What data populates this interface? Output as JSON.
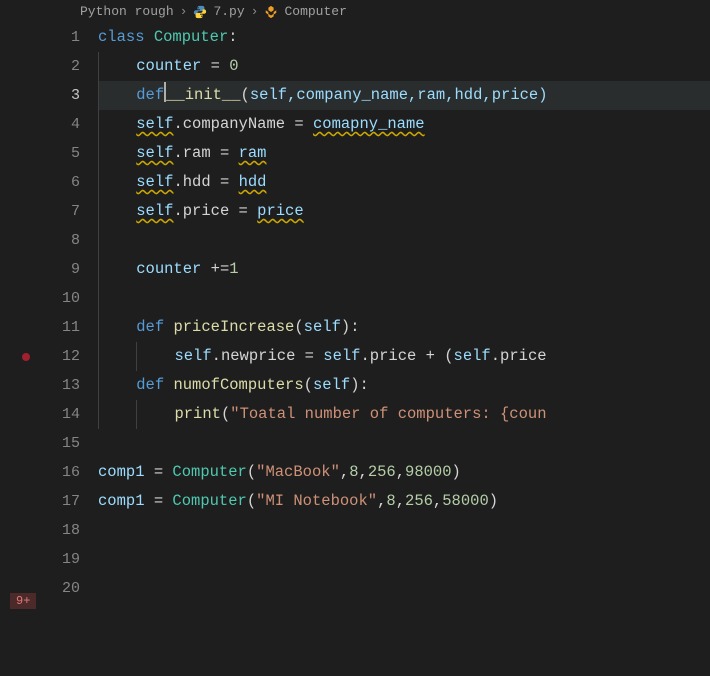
{
  "breadcrumb": {
    "root": "Python rough",
    "file": "7.py",
    "symbol": "Computer"
  },
  "editor": {
    "activeLine": 3,
    "badge": "9+"
  },
  "code": {
    "l1": {
      "kw": "class",
      "cls": "Computer",
      "colon": ":"
    },
    "l2": {
      "var": "counter",
      "eq": " = ",
      "num": "0"
    },
    "l3": {
      "kw": "def",
      "fn": "__init__",
      "open": "(",
      "self": "self",
      "params": ",company_name,ram,hdd,price)"
    },
    "l4": {
      "self": "self",
      "dot": ".companyName = ",
      "rhs": "comapny_name"
    },
    "l5": {
      "self": "self",
      "dot": ".ram = ",
      "rhs": "ram"
    },
    "l6": {
      "self": "self",
      "dot": ".hdd = ",
      "rhs": "hdd"
    },
    "l7": {
      "self": "self",
      "dot": ".price = ",
      "rhs": "price"
    },
    "l9": {
      "var": "counter",
      "rest": " +=",
      "num": "1"
    },
    "l11": {
      "kw": "def",
      "fn": "priceIncrease",
      "open": "(",
      "self": "self",
      "close": "):"
    },
    "l12": {
      "self1": "self",
      "mid1": ".newprice = ",
      "self2": "self",
      "mid2": ".price + (",
      "self3": "self",
      "mid3": ".price"
    },
    "l13": {
      "kw": "def",
      "fn": "numofComputers",
      "open": "(",
      "self": "self",
      "close": "):"
    },
    "l14": {
      "fn": "print",
      "open": "(",
      "str": "\"Toatal number of computers: {coun"
    },
    "l16": {
      "var": "comp1",
      "eq": " = ",
      "cls": "Computer",
      "open": "(",
      "str": "\"MacBook\"",
      "rest": ",",
      "n1": "8",
      "c1": ",",
      "n2": "256",
      "c2": ",",
      "n3": "98000",
      "close": ")"
    },
    "l17": {
      "var": "comp1",
      "eq": " = ",
      "cls": "Computer",
      "open": "(",
      "str": "\"MI Notebook\"",
      "rest": ",",
      "n1": "8",
      "c1": ",",
      "n2": "256",
      "c2": ",",
      "n3": "58000",
      "close": ")"
    }
  },
  "lineNumbers": [
    "1",
    "2",
    "3",
    "4",
    "5",
    "6",
    "7",
    "8",
    "9",
    "10",
    "11",
    "12",
    "13",
    "14",
    "15",
    "16",
    "17",
    "18",
    "19",
    "20"
  ]
}
